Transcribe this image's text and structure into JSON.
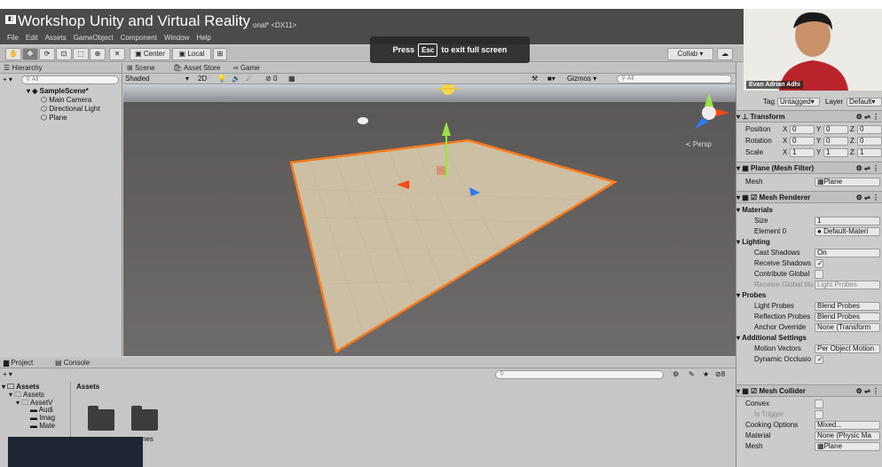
{
  "meeting": {
    "title": "Workshop Unity and Virtual Reality",
    "editor_suffix": "onal* <DX11>",
    "fullscreen_pre": "Press",
    "fullscreen_key": "Esc",
    "fullscreen_post": "to exit full screen",
    "participant_name": "Evan Adrian Adhi"
  },
  "menu": [
    "File",
    "Edit",
    "Assets",
    "GameObject",
    "Component",
    "Window",
    "Help"
  ],
  "toolbar": {
    "pivot_label": "Center",
    "space_label": "Local",
    "collab_label": "Collab ▾"
  },
  "hierarchy": {
    "tab": "Hierarchy",
    "search_placeholder": "All",
    "scene": "SampleScene*",
    "items": [
      "Main Camera",
      "Directional Light",
      "Plane"
    ]
  },
  "scene_tabs": [
    "Scene",
    "Asset Store",
    "Game"
  ],
  "scene_bar": {
    "shading": "Shaded",
    "mode_2d": "2D",
    "hidden_count": "0",
    "gizmos": "Gizmos",
    "search_placeholder": "All",
    "persp": "≺ Persp"
  },
  "project": {
    "tabs": [
      "Project",
      "Console"
    ],
    "breadcrumb": "Assets",
    "tree": [
      "Assets",
      "Assets",
      "AssetV",
      "Audi",
      "Imag",
      "Mate"
    ],
    "search_count": "8",
    "partial_label": "nes"
  },
  "inspector": {
    "tag_label": "Tag",
    "tag_value": "Untagged",
    "layer_label": "Layer",
    "layer_value": "Default",
    "transform": {
      "title": "Transform",
      "rows": [
        {
          "label": "Position",
          "x": "0",
          "y": "0",
          "z": "0"
        },
        {
          "label": "Rotation",
          "x": "0",
          "y": "0",
          "z": "0"
        },
        {
          "label": "Scale",
          "x": "1",
          "y": "1",
          "z": "1"
        }
      ]
    },
    "mesh_filter": {
      "title": "Plane (Mesh Filter)",
      "mesh_label": "Mesh",
      "mesh_value": "Plane"
    },
    "mesh_renderer": {
      "title": "Mesh Renderer",
      "materials": "Materials",
      "size_label": "Size",
      "size_value": "1",
      "element_label": "Element 0",
      "element_value": "Default-Materi",
      "lighting": "Lighting",
      "cast_shadows_label": "Cast Shadows",
      "cast_shadows_value": "On",
      "receive_shadows_label": "Receive Shadows",
      "contribute_gi_label": "Contribute Global",
      "receive_gi_label": "Receive Global Illu",
      "receive_gi_value": "Light Probes",
      "probes": "Probes",
      "light_probes_label": "Light Probes",
      "light_probes_value": "Blend Probes",
      "reflection_label": "Reflection Probes",
      "reflection_value": "Blend Probes",
      "anchor_label": "Anchor Override",
      "anchor_value": "None (Transform",
      "additional": "Additional Settings",
      "motion_label": "Motion Vectors",
      "motion_value": "Per Object Motion",
      "occlusion_label": "Dynamic Occlusio"
    },
    "mesh_collider": {
      "title": "Mesh Collider",
      "convex_label": "Convex",
      "trigger_label": "Is Trigger",
      "cooking_label": "Cooking Options",
      "cooking_value": "Mixed...",
      "material_label": "Material",
      "material_value": "None (Physic Ma",
      "mesh_label": "Mesh",
      "mesh_value": "Plane"
    }
  },
  "colors": {
    "editor_bg": "#cbcbcb",
    "plane": "#ccbfa3",
    "outline": "#ff7a1a",
    "scene_bg": "#5e5c5a"
  }
}
